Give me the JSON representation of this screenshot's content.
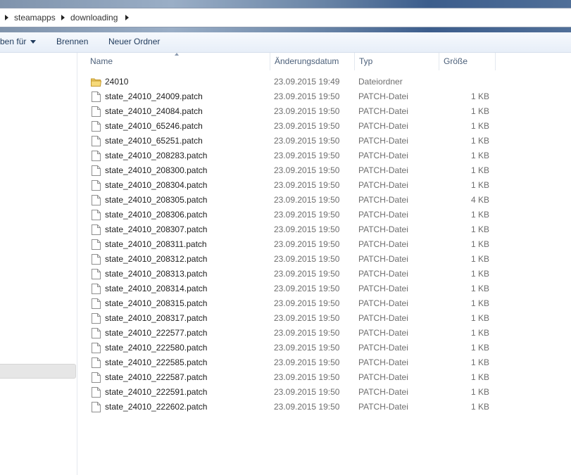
{
  "breadcrumb": [
    "steamapps",
    "downloading"
  ],
  "toolbar": {
    "share_label": "ben für",
    "burn_label": "Brennen",
    "new_folder_label": "Neuer Ordner"
  },
  "columns": {
    "name": "Name",
    "modified": "Änderungsdatum",
    "type": "Typ",
    "size": "Größe"
  },
  "files": [
    {
      "name": "24010",
      "modified": "23.09.2015 19:49",
      "type": "Dateiordner",
      "size": "",
      "icon": "folder-icon"
    },
    {
      "name": "state_24010_24009.patch",
      "modified": "23.09.2015 19:50",
      "type": "PATCH-Datei",
      "size": "1 KB",
      "icon": "file-icon"
    },
    {
      "name": "state_24010_24084.patch",
      "modified": "23.09.2015 19:50",
      "type": "PATCH-Datei",
      "size": "1 KB",
      "icon": "file-icon"
    },
    {
      "name": "state_24010_65246.patch",
      "modified": "23.09.2015 19:50",
      "type": "PATCH-Datei",
      "size": "1 KB",
      "icon": "file-icon"
    },
    {
      "name": "state_24010_65251.patch",
      "modified": "23.09.2015 19:50",
      "type": "PATCH-Datei",
      "size": "1 KB",
      "icon": "file-icon"
    },
    {
      "name": "state_24010_208283.patch",
      "modified": "23.09.2015 19:50",
      "type": "PATCH-Datei",
      "size": "1 KB",
      "icon": "file-icon"
    },
    {
      "name": "state_24010_208300.patch",
      "modified": "23.09.2015 19:50",
      "type": "PATCH-Datei",
      "size": "1 KB",
      "icon": "file-icon"
    },
    {
      "name": "state_24010_208304.patch",
      "modified": "23.09.2015 19:50",
      "type": "PATCH-Datei",
      "size": "1 KB",
      "icon": "file-icon"
    },
    {
      "name": "state_24010_208305.patch",
      "modified": "23.09.2015 19:50",
      "type": "PATCH-Datei",
      "size": "4 KB",
      "icon": "file-icon"
    },
    {
      "name": "state_24010_208306.patch",
      "modified": "23.09.2015 19:50",
      "type": "PATCH-Datei",
      "size": "1 KB",
      "icon": "file-icon"
    },
    {
      "name": "state_24010_208307.patch",
      "modified": "23.09.2015 19:50",
      "type": "PATCH-Datei",
      "size": "1 KB",
      "icon": "file-icon"
    },
    {
      "name": "state_24010_208311.patch",
      "modified": "23.09.2015 19:50",
      "type": "PATCH-Datei",
      "size": "1 KB",
      "icon": "file-icon"
    },
    {
      "name": "state_24010_208312.patch",
      "modified": "23.09.2015 19:50",
      "type": "PATCH-Datei",
      "size": "1 KB",
      "icon": "file-icon"
    },
    {
      "name": "state_24010_208313.patch",
      "modified": "23.09.2015 19:50",
      "type": "PATCH-Datei",
      "size": "1 KB",
      "icon": "file-icon"
    },
    {
      "name": "state_24010_208314.patch",
      "modified": "23.09.2015 19:50",
      "type": "PATCH-Datei",
      "size": "1 KB",
      "icon": "file-icon"
    },
    {
      "name": "state_24010_208315.patch",
      "modified": "23.09.2015 19:50",
      "type": "PATCH-Datei",
      "size": "1 KB",
      "icon": "file-icon"
    },
    {
      "name": "state_24010_208317.patch",
      "modified": "23.09.2015 19:50",
      "type": "PATCH-Datei",
      "size": "1 KB",
      "icon": "file-icon"
    },
    {
      "name": "state_24010_222577.patch",
      "modified": "23.09.2015 19:50",
      "type": "PATCH-Datei",
      "size": "1 KB",
      "icon": "file-icon"
    },
    {
      "name": "state_24010_222580.patch",
      "modified": "23.09.2015 19:50",
      "type": "PATCH-Datei",
      "size": "1 KB",
      "icon": "file-icon"
    },
    {
      "name": "state_24010_222585.patch",
      "modified": "23.09.2015 19:50",
      "type": "PATCH-Datei",
      "size": "1 KB",
      "icon": "file-icon"
    },
    {
      "name": "state_24010_222587.patch",
      "modified": "23.09.2015 19:50",
      "type": "PATCH-Datei",
      "size": "1 KB",
      "icon": "file-icon"
    },
    {
      "name": "state_24010_222591.patch",
      "modified": "23.09.2015 19:50",
      "type": "PATCH-Datei",
      "size": "1 KB",
      "icon": "file-icon"
    },
    {
      "name": "state_24010_222602.patch",
      "modified": "23.09.2015 19:50",
      "type": "PATCH-Datei",
      "size": "1 KB",
      "icon": "file-icon"
    }
  ],
  "colors": {
    "header_text": "#4c607a",
    "meta_text": "#6d6d6d",
    "toolbar_text": "#1e395b"
  }
}
